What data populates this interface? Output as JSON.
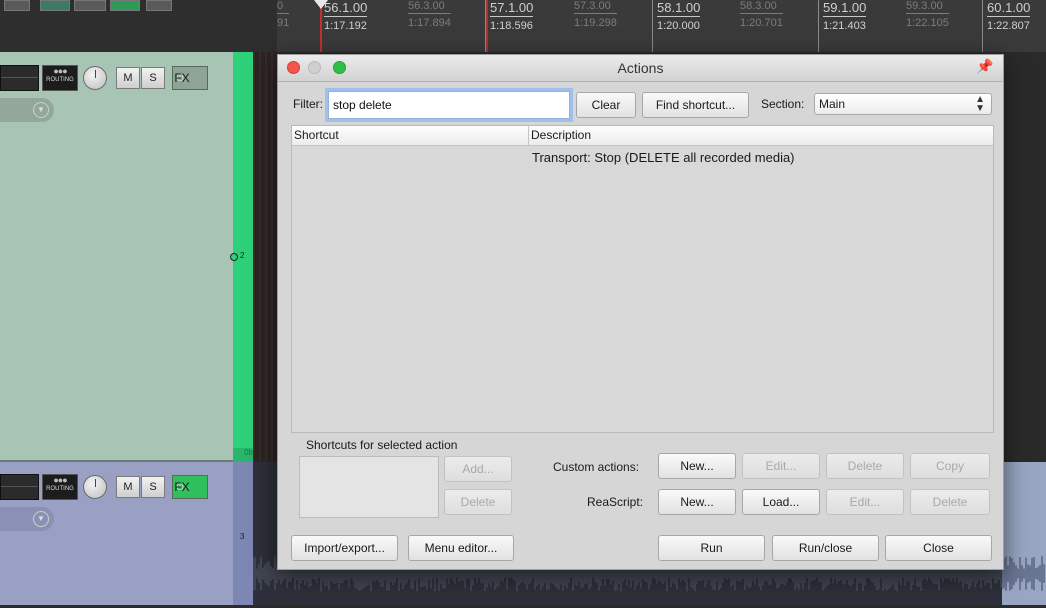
{
  "ruler": {
    "ticks": [
      {
        "bar": "0",
        "time": "91",
        "dim": true
      },
      {
        "bar": "56.1.00",
        "time": "1:17.192",
        "dim": false
      },
      {
        "bar": "56.3.00",
        "time": "1:17.894",
        "dim": true
      },
      {
        "bar": "57.1.00",
        "time": "1:18.596",
        "dim": false
      },
      {
        "bar": "57.3.00",
        "time": "1:19.298",
        "dim": true
      },
      {
        "bar": "58.1.00",
        "time": "1:20.000",
        "dim": false
      },
      {
        "bar": "58.3.00",
        "time": "1:20.701",
        "dim": true
      },
      {
        "bar": "59.1.00",
        "time": "1:21.403",
        "dim": false
      },
      {
        "bar": "59.3.00",
        "time": "1:22.105",
        "dim": true
      },
      {
        "bar": "60.1.00",
        "time": "1:22.807",
        "dim": false
      }
    ]
  },
  "tracks": [
    {
      "routing_label": "ROUTING",
      "mute": "M",
      "solo": "S",
      "fx": "FX",
      "fx_active": false,
      "meter_number": "2",
      "meter_foot": "0b",
      "color": "#a7c4b4"
    },
    {
      "routing_label": "ROUTING",
      "mute": "M",
      "solo": "S",
      "fx": "FX",
      "fx_active": true,
      "meter_number": "3",
      "color": "#9aa0c4"
    }
  ],
  "dialog": {
    "title": "Actions",
    "filter_label": "Filter:",
    "filter_value": "stop delete",
    "clear_label": "Clear",
    "find_shortcut_label": "Find shortcut...",
    "section_label": "Section:",
    "section_value": "Main",
    "columns": {
      "shortcut": "Shortcut",
      "description": "Description"
    },
    "rows": [
      {
        "shortcut": "",
        "description": "Transport: Stop (DELETE all recorded media)"
      }
    ],
    "shortcuts_group_label": "Shortcuts for selected action",
    "add_label": "Add...",
    "delete_label": "Delete",
    "custom_actions_label": "Custom actions:",
    "custom_new": "New...",
    "custom_edit": "Edit...",
    "custom_delete": "Delete",
    "custom_copy": "Copy",
    "reascript_label": "ReaScript:",
    "reascript_new": "New...",
    "reascript_load": "Load...",
    "reascript_edit": "Edit...",
    "reascript_delete": "Delete",
    "import_export": "Import/export...",
    "menu_editor": "Menu editor...",
    "run": "Run",
    "run_close": "Run/close",
    "close": "Close"
  },
  "colors": {
    "meter_green": "#2fd07a",
    "close_light": "#f2564d",
    "max_light": "#2fbf45",
    "focus_ring": "#9fc0ec"
  },
  "icons": {
    "pin": "pin-icon",
    "section_chevron": "updown-chevron-icon",
    "knob": "volume-knob-icon",
    "envelope_arrow": "chevron-down-icon"
  }
}
